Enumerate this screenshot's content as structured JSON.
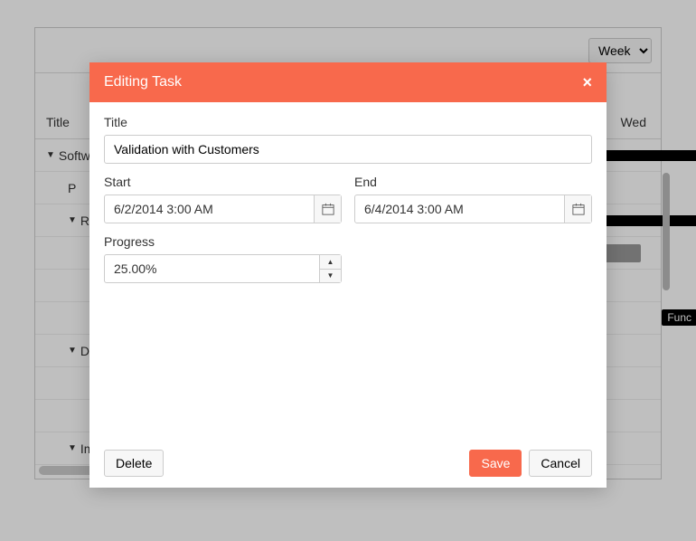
{
  "toolbar": {
    "view_label": "Week"
  },
  "headers": {
    "title_col": "Title",
    "day": "Wed"
  },
  "rows": {
    "r0": "Software validation, research and implementation",
    "r1": "P",
    "r2": "Research",
    "r3": "",
    "r4": "",
    "r5": "Func",
    "r6": "Design",
    "r7": "",
    "r8": "",
    "r9": "Implementation"
  },
  "dialog": {
    "title": "Editing Task",
    "fields": {
      "title_label": "Title",
      "title_value": "Validation with Customers",
      "start_label": "Start",
      "start_value": "6/2/2014 3:00 AM",
      "end_label": "End",
      "end_value": "6/4/2014 3:00 AM",
      "progress_label": "Progress",
      "progress_value": "25.00%"
    },
    "buttons": {
      "delete": "Delete",
      "save": "Save",
      "cancel": "Cancel"
    }
  }
}
